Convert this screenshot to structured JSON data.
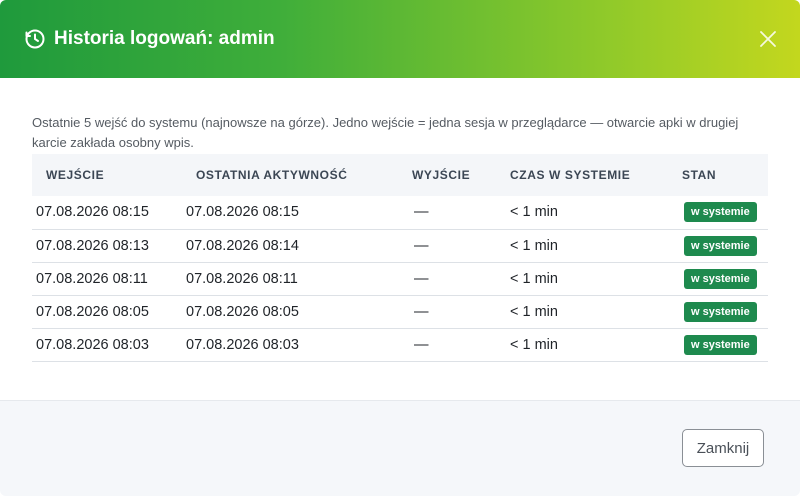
{
  "modal": {
    "title": "Historia logowań: admin",
    "icon": "clock-icon",
    "close_icon": "close-icon",
    "header_colors": {
      "from": "#1f9a3c",
      "to": "#c3d71e"
    }
  },
  "intro_text": "Ostatnie 5 wejść do systemu (najnowsze na górze). Jedno wejście = jedna sesja w przeglądarce — otwarcie apki w drugiej karcie zakłada osobny wpis.",
  "table": {
    "headers": [
      "WEJŚCIE",
      "OSTATNIA AKTYWNOŚĆ",
      "WYJŚCIE",
      "CZAS W SYSTEMIE",
      "STAN"
    ],
    "rows": [
      {
        "login": "07.08.2026 08:15",
        "last": "07.08.2026 08:15",
        "logout": "—",
        "duration": "< 1 min",
        "state": "w systemie"
      },
      {
        "login": "07.08.2026 08:13",
        "last": "07.08.2026 08:14",
        "logout": "—",
        "duration": "< 1 min",
        "state": "w systemie"
      },
      {
        "login": "07.08.2026 08:11",
        "last": "07.08.2026 08:11",
        "logout": "—",
        "duration": "< 1 min",
        "state": "w systemie"
      },
      {
        "login": "07.08.2026 08:05",
        "last": "07.08.2026 08:05",
        "logout": "—",
        "duration": "< 1 min",
        "state": "w systemie"
      },
      {
        "login": "07.08.2026 08:03",
        "last": "07.08.2026 08:03",
        "logout": "—",
        "duration": "< 1 min",
        "state": "w systemie"
      }
    ],
    "badge_color": "#1e8a4e"
  },
  "footer": {
    "close_label": "Zamknij"
  }
}
